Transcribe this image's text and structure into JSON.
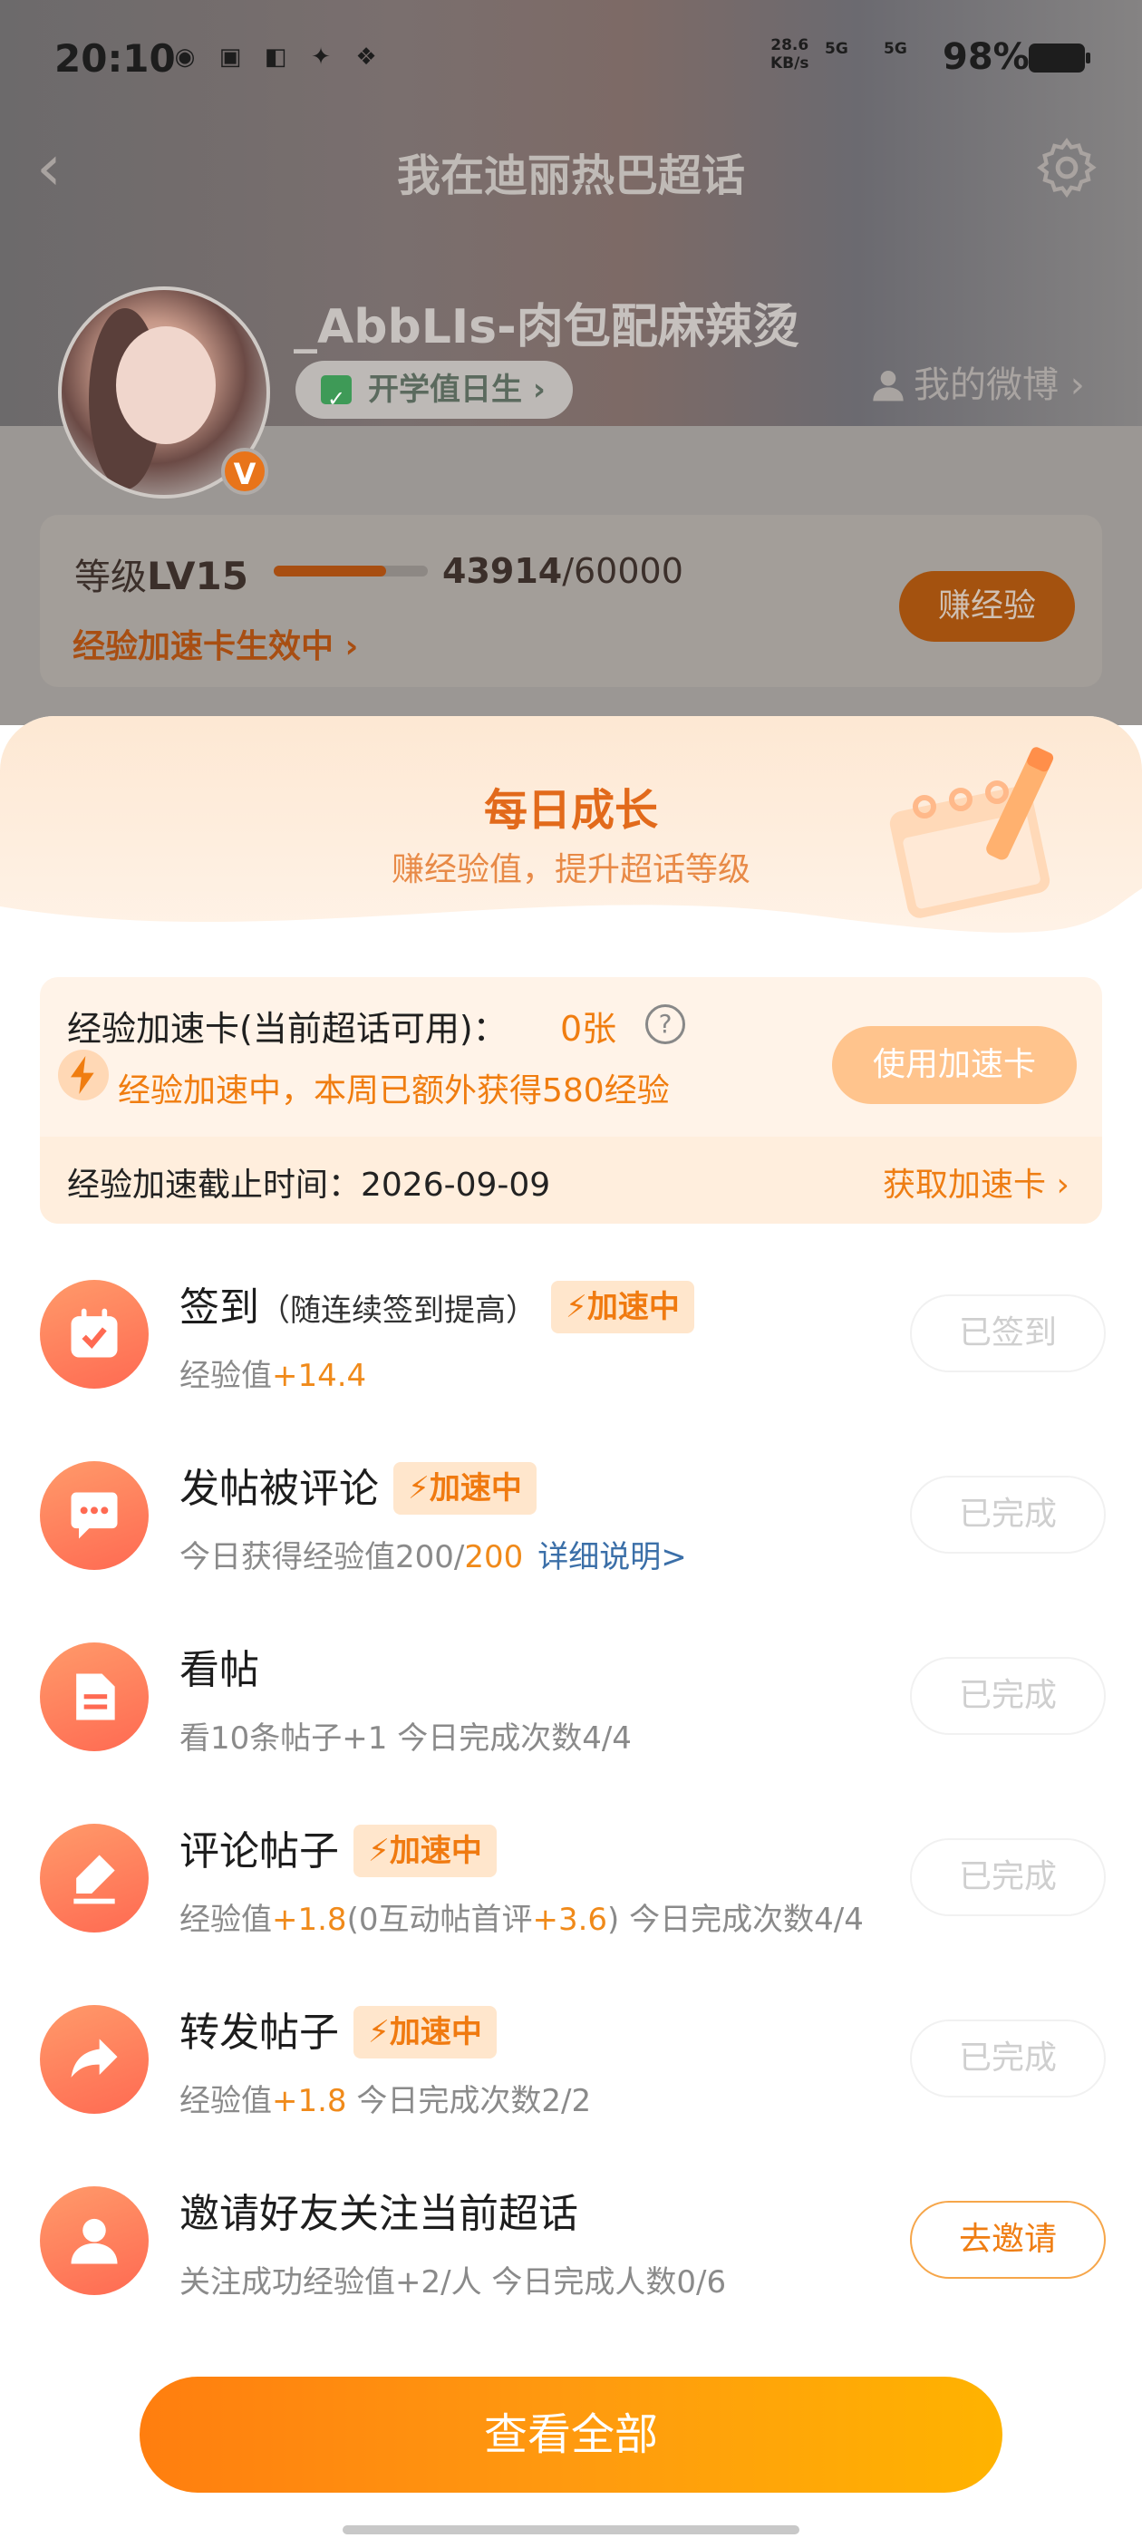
{
  "status_bar": {
    "time": "20:10",
    "app_icons": [
      "weibo-icon",
      "tie-icon",
      "taobao-icon",
      "bird-icon",
      "wechat-icon"
    ],
    "net_speed": "28.6",
    "net_unit": "KB/s",
    "sig1": "5G",
    "sig2": "5G",
    "battery": "98%"
  },
  "nav": {
    "title": "我在迪丽热巴超话"
  },
  "profile": {
    "username": "_AbbLIs-肉包配麻辣烫",
    "tag": "开学值日生",
    "my_weibo": "我的微博",
    "badge": "V"
  },
  "level": {
    "prefix": "等级",
    "level": "LV15",
    "current": "43914",
    "max": "/60000",
    "progress_fraction": 0.73,
    "boost_link": "经验加速卡生效中",
    "earn_button": "赚经验"
  },
  "sheet": {
    "title": "每日成长",
    "subtitle": "赚经验值，提升超话等级"
  },
  "accel": {
    "title": "经验加速卡(当前超话可用)：",
    "count": "0张",
    "status": "经验加速中，本周已额外获得580经验",
    "use_button": "使用加速卡",
    "deadline": "经验加速截止时间：2026-09-09",
    "get_card": "获取加速卡"
  },
  "boost_label": "加速中",
  "tasks": [
    {
      "name": "签到",
      "note": "（随连续签到提高）",
      "desc_a": "经验值",
      "desc_hl": "+14.4",
      "button": "已签到"
    },
    {
      "name": "发帖被评论",
      "desc_a": "今日获得经验值200/",
      "desc_hl": "200",
      "link": "详细说明>",
      "button": "已完成"
    },
    {
      "name": "看帖",
      "desc_a": "看10条帖子+1   今日完成次数4/4",
      "button": "已完成"
    },
    {
      "name": "评论帖子",
      "desc_a": "经验值",
      "desc_hl": "+1.8",
      "desc_b": "(0互动帖首评",
      "desc_hl2": "+3.6",
      "desc_c": ")   今日完成次数4/4",
      "button": "已完成"
    },
    {
      "name": "转发帖子",
      "desc_a": "经验值",
      "desc_hl": "+1.8",
      "desc_b": "   今日完成次数2/2",
      "button": "已完成"
    },
    {
      "name": "邀请好友关注当前超话",
      "desc_a": "关注成功经验值+2/人   今日完成人数0/6",
      "button": "去邀请"
    }
  ],
  "view_all": "查看全部",
  "colors": {
    "accent": "#ff8a10",
    "highlight": "#f08a1a",
    "link": "#3b6fa8"
  }
}
